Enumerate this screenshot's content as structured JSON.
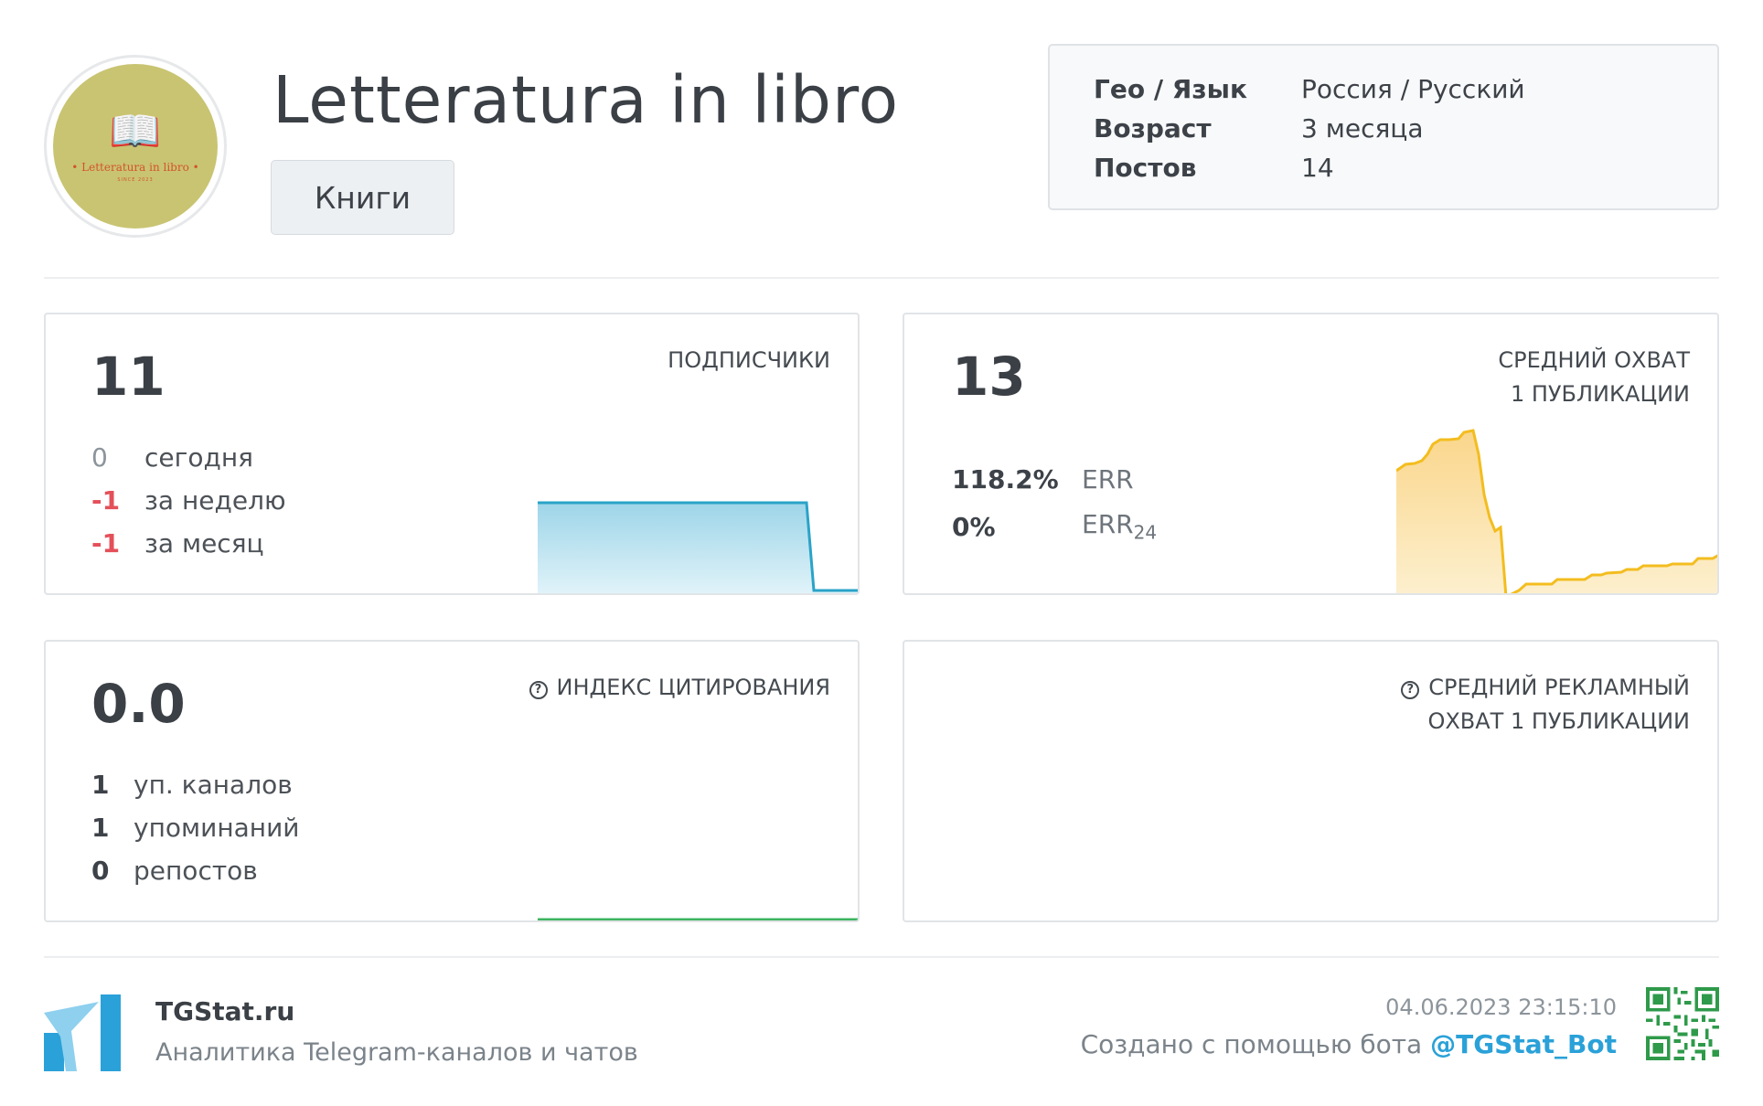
{
  "channel": {
    "title": "Letteratura in libro",
    "category": "Книги",
    "avatar_text": "• Letteratura in libro •",
    "avatar_sub": "SINCE 2023",
    "avatar_icon": "open-book-icon"
  },
  "info": {
    "rows": [
      {
        "key": "Гео / Язык",
        "value": "Россия / Русский"
      },
      {
        "key": "Возраст",
        "value": "3 месяца"
      },
      {
        "key": "Постов",
        "value": "14"
      }
    ]
  },
  "subscribers": {
    "value": "11",
    "label": "ПОДПИСЧИКИ",
    "rows": [
      {
        "num": "0",
        "label": "сегодня",
        "color": "#8c949b"
      },
      {
        "num": "-1",
        "label": "за неделю",
        "color": "#e4505a"
      },
      {
        "num": "-1",
        "label": "за месяц",
        "color": "#e4505a"
      }
    ],
    "spark_color": "#2aa3c8"
  },
  "reach": {
    "value": "13",
    "label_line1": "СРЕДНИЙ ОХВАТ",
    "label_line2": "1 ПУБЛИКАЦИИ",
    "err_value": "118.2%",
    "err_label": "ERR",
    "err24_value": "0%",
    "err24_label": "ERR",
    "err24_sub": "24",
    "spark_color": "#f3bd1f"
  },
  "citation": {
    "value": "0.0",
    "label": "ИНДЕКС ЦИТИРОВАНИЯ",
    "rows": [
      {
        "num": "1",
        "label": "уп. каналов"
      },
      {
        "num": "1",
        "label": "упоминаний"
      },
      {
        "num": "0",
        "label": "репостов"
      }
    ],
    "spark_color": "#3cb460"
  },
  "ad_reach": {
    "label_line1": "СРЕДНИЙ РЕКЛАМНЫЙ",
    "label_line2": "ОХВАТ 1 ПУБЛИКАЦИИ"
  },
  "footer": {
    "name": "TGStat.ru",
    "tagline": "Аналитика Telegram-каналов и чатов",
    "date": "04.06.2023 23:15:10",
    "credit_text": "Создано с помощью бота ",
    "credit_link": "@TGStat_Bot",
    "logo_color": "#2aa1d8"
  }
}
